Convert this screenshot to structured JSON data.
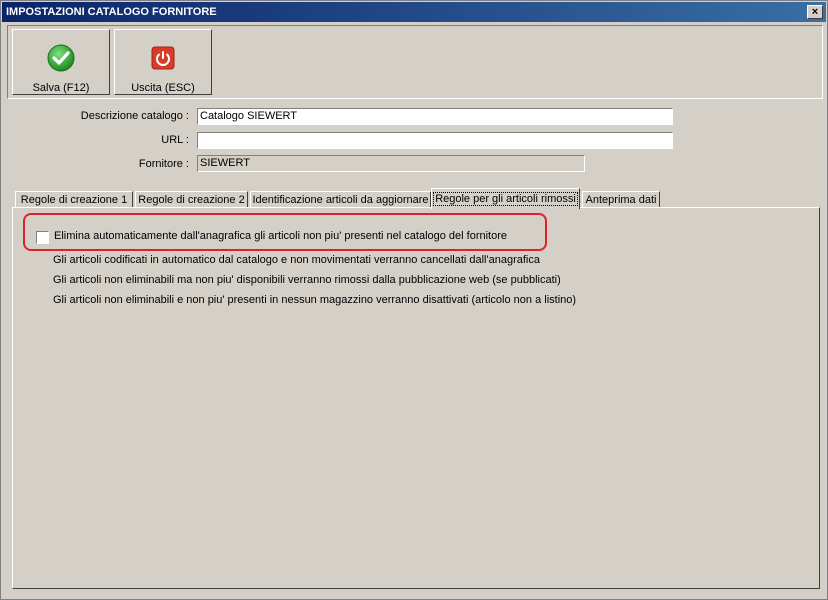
{
  "window": {
    "title": "IMPOSTAZIONI CATALOGO FORNITORE",
    "close_symbol": "×"
  },
  "toolbar": {
    "save_label": "Salva (F12)",
    "exit_label": "Uscita (ESC)",
    "save_icon": "check-circle-icon",
    "exit_icon": "power-icon"
  },
  "form": {
    "descrizione_label": "Descrizione catalogo :",
    "descrizione_value": "Catalogo SIEWERT",
    "url_label": "URL :",
    "url_value": "",
    "fornitore_label": "Fornitore :",
    "fornitore_value": "SIEWERT"
  },
  "tabs": [
    {
      "label": "Regole di creazione 1"
    },
    {
      "label": "Regole di creazione 2"
    },
    {
      "label": "Identificazione articoli da aggiornare"
    },
    {
      "label": "Regole per gli articoli rimossi"
    },
    {
      "label": "Anteprima dati"
    }
  ],
  "active_tab": "Regole per gli articoli rimossi",
  "panel": {
    "checkbox_label": "Elimina automaticamente dall'anagrafica gli articoli non piu' presenti nel catalogo del fornitore",
    "checkbox_checked": false,
    "notes": [
      "Gli articoli codificati in automatico dal catalogo e non movimentati verranno cancellati dall'anagrafica",
      "Gli articoli non eliminabili ma non piu' disponibili verranno rimossi dalla pubblicazione web (se pubblicati)",
      "Gli articoli non eliminabili e non piu' presenti in nessun magazzino verranno disattivati (articolo non a listino)"
    ]
  },
  "colors": {
    "highlight": "#e0202a",
    "titlebar": "#0a246a",
    "save_green": "#2fa02f",
    "exit_red": "#d93a2a"
  }
}
